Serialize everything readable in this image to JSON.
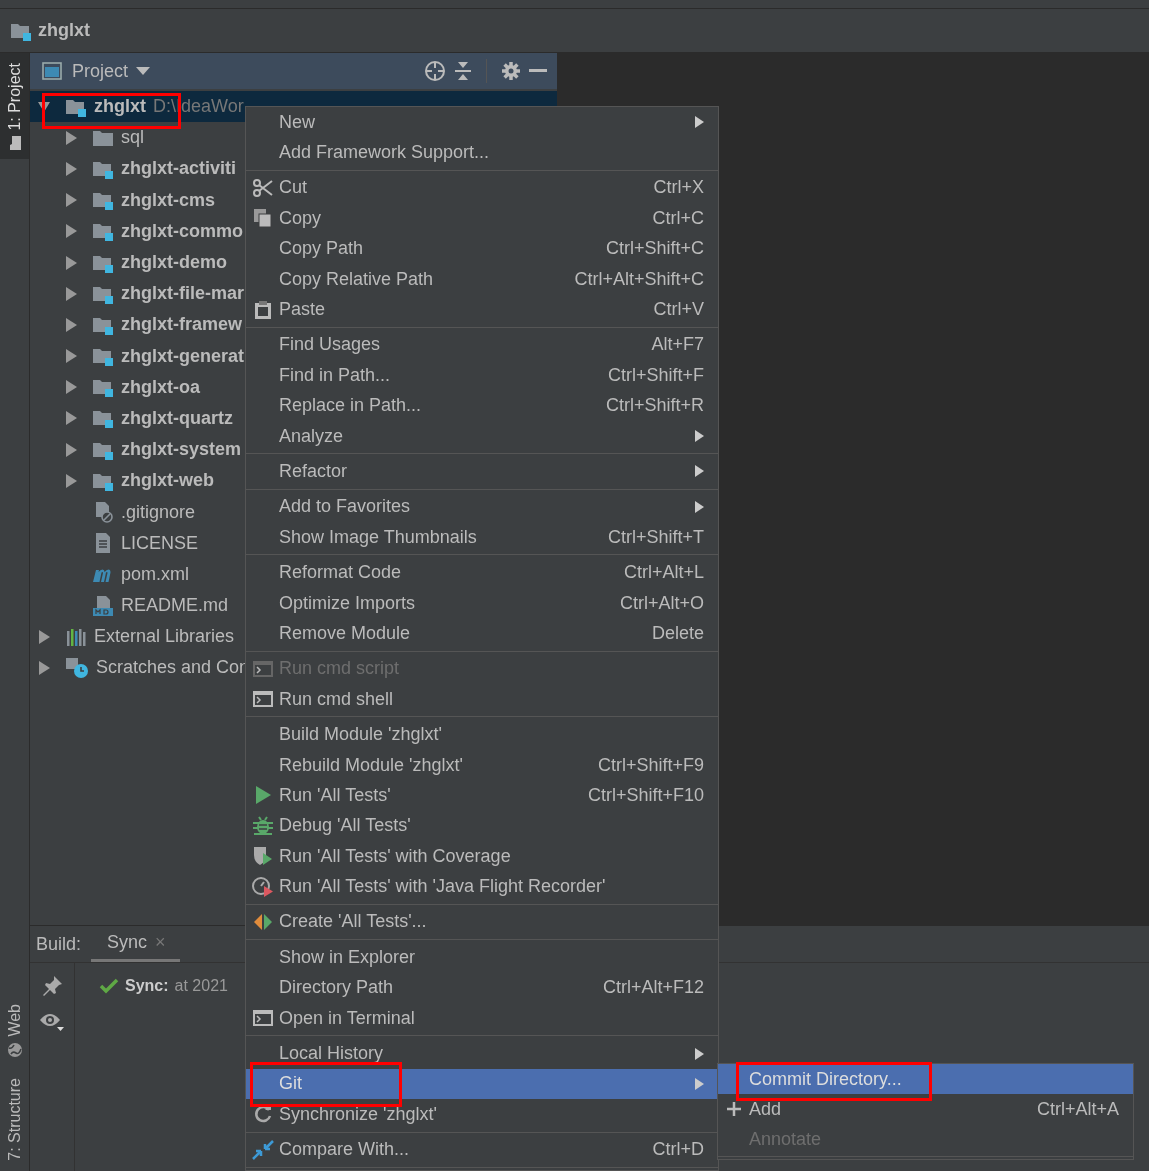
{
  "title_bar": {
    "title": "zhglxt"
  },
  "side_strip": {
    "top": [
      {
        "label": "1: Project",
        "selected": true
      }
    ],
    "bottom": [
      {
        "label": "Web",
        "selected": false
      },
      {
        "label": "7: Structure",
        "selected": false
      }
    ]
  },
  "project_panel": {
    "title": "Project",
    "tree": [
      {
        "name": "zhglxt",
        "path": "D:\\IdeaWor",
        "kind": "module",
        "expanded": true,
        "selected": true,
        "children": [
          {
            "name": "sql",
            "kind": "folder",
            "expanded": false,
            "selected": false
          },
          {
            "name": "zhglxt-activiti",
            "kind": "module",
            "expanded": false,
            "selected": false
          },
          {
            "name": "zhglxt-cms",
            "kind": "module",
            "expanded": false,
            "selected": false
          },
          {
            "name": "zhglxt-commo",
            "kind": "module",
            "expanded": false,
            "selected": false
          },
          {
            "name": "zhglxt-demo",
            "kind": "module",
            "expanded": false,
            "selected": false
          },
          {
            "name": "zhglxt-file-mar",
            "kind": "module",
            "expanded": false,
            "selected": false
          },
          {
            "name": "zhglxt-framew",
            "kind": "module",
            "expanded": false,
            "selected": false
          },
          {
            "name": "zhglxt-generat",
            "kind": "module",
            "expanded": false,
            "selected": false
          },
          {
            "name": "zhglxt-oa",
            "kind": "module",
            "expanded": false,
            "selected": false
          },
          {
            "name": "zhglxt-quartz",
            "kind": "module",
            "expanded": false,
            "selected": false
          },
          {
            "name": "zhglxt-system",
            "kind": "module",
            "expanded": false,
            "selected": false
          },
          {
            "name": "zhglxt-web",
            "kind": "module",
            "expanded": false,
            "selected": false
          },
          {
            "name": ".gitignore",
            "kind": "ignore",
            "selected": false
          },
          {
            "name": "LICENSE",
            "kind": "file",
            "selected": false
          },
          {
            "name": "pom.xml",
            "kind": "maven",
            "selected": false
          },
          {
            "name": "README.md",
            "kind": "markdown",
            "selected": false
          }
        ]
      },
      {
        "name": "External Libraries",
        "kind": "libraries",
        "expanded": false,
        "selected": false
      },
      {
        "name": "Scratches and Con",
        "kind": "scratches",
        "expanded": false,
        "selected": false
      }
    ]
  },
  "build_panel": {
    "label": "Build:",
    "tabs": [
      {
        "label": "Sync",
        "selected": true,
        "close": "×"
      }
    ],
    "status": {
      "title": "Sync:",
      "text": "at 2021"
    }
  },
  "context_menu": {
    "groups": [
      [
        {
          "label": "New",
          "submenu": true,
          "disabled": false,
          "selected": false
        },
        {
          "label": "Add Framework Support...",
          "disabled": false,
          "selected": false
        }
      ],
      [
        {
          "label": "Cut",
          "shortcut": "Ctrl+X",
          "disabled": false,
          "selected": false
        },
        {
          "label": "Copy",
          "shortcut": "Ctrl+C",
          "disabled": false,
          "selected": false
        },
        {
          "label": "Copy Path",
          "shortcut": "Ctrl+Shift+C",
          "disabled": false,
          "selected": false
        },
        {
          "label": "Copy Relative Path",
          "shortcut": "Ctrl+Alt+Shift+C",
          "disabled": false,
          "selected": false
        },
        {
          "label": "Paste",
          "shortcut": "Ctrl+V",
          "disabled": false,
          "selected": false
        }
      ],
      [
        {
          "label": "Find Usages",
          "shortcut": "Alt+F7",
          "disabled": false,
          "selected": false
        },
        {
          "label": "Find in Path...",
          "shortcut": "Ctrl+Shift+F",
          "disabled": false,
          "selected": false
        },
        {
          "label": "Replace in Path...",
          "shortcut": "Ctrl+Shift+R",
          "disabled": false,
          "selected": false
        },
        {
          "label": "Analyze",
          "submenu": true,
          "disabled": false,
          "selected": false
        }
      ],
      [
        {
          "label": "Refactor",
          "submenu": true,
          "disabled": false,
          "selected": false
        }
      ],
      [
        {
          "label": "Add to Favorites",
          "submenu": true,
          "disabled": false,
          "selected": false
        },
        {
          "label": "Show Image Thumbnails",
          "shortcut": "Ctrl+Shift+T",
          "disabled": false,
          "selected": false
        }
      ],
      [
        {
          "label": "Reformat Code",
          "shortcut": "Ctrl+Alt+L",
          "disabled": false,
          "selected": false
        },
        {
          "label": "Optimize Imports",
          "shortcut": "Ctrl+Alt+O",
          "disabled": false,
          "selected": false
        },
        {
          "label": "Remove Module",
          "shortcut": "Delete",
          "disabled": false,
          "selected": false
        }
      ],
      [
        {
          "label": "Run cmd script",
          "disabled": true,
          "selected": false
        },
        {
          "label": "Run cmd shell",
          "disabled": false,
          "selected": false
        }
      ],
      [
        {
          "label": "Build Module 'zhglxt'",
          "disabled": false,
          "selected": false
        },
        {
          "label": "Rebuild Module 'zhglxt'",
          "shortcut": "Ctrl+Shift+F9",
          "disabled": false,
          "selected": false
        },
        {
          "label": "Run 'All Tests'",
          "shortcut": "Ctrl+Shift+F10",
          "disabled": false,
          "selected": false
        },
        {
          "label": "Debug 'All Tests'",
          "disabled": false,
          "selected": false
        },
        {
          "label": "Run 'All Tests' with Coverage",
          "disabled": false,
          "selected": false
        },
        {
          "label": "Run 'All Tests' with 'Java Flight Recorder'",
          "disabled": false,
          "selected": false
        }
      ],
      [
        {
          "label": "Create 'All Tests'...",
          "disabled": false,
          "selected": false
        }
      ],
      [
        {
          "label": "Show in Explorer",
          "disabled": false,
          "selected": false
        },
        {
          "label": "Directory Path",
          "shortcut": "Ctrl+Alt+F12",
          "disabled": false,
          "selected": false
        },
        {
          "label": "Open in Terminal",
          "disabled": false,
          "selected": false
        }
      ],
      [
        {
          "label": "Local History",
          "submenu": true,
          "disabled": false,
          "selected": false
        },
        {
          "label": "Git",
          "submenu": true,
          "disabled": false,
          "selected": true
        },
        {
          "label": "Synchronize 'zhglxt'",
          "disabled": false,
          "selected": false
        }
      ],
      [
        {
          "label": "Compare With...",
          "shortcut": "Ctrl+D",
          "disabled": false,
          "selected": false
        }
      ]
    ]
  },
  "git_submenu": {
    "items": [
      {
        "label": "Commit Directory...",
        "disabled": false,
        "selected": true
      },
      {
        "label": "Add",
        "shortcut": "Ctrl+Alt+A",
        "disabled": false,
        "selected": false
      },
      {
        "label": "Annotate",
        "disabled": true,
        "selected": false
      }
    ]
  }
}
